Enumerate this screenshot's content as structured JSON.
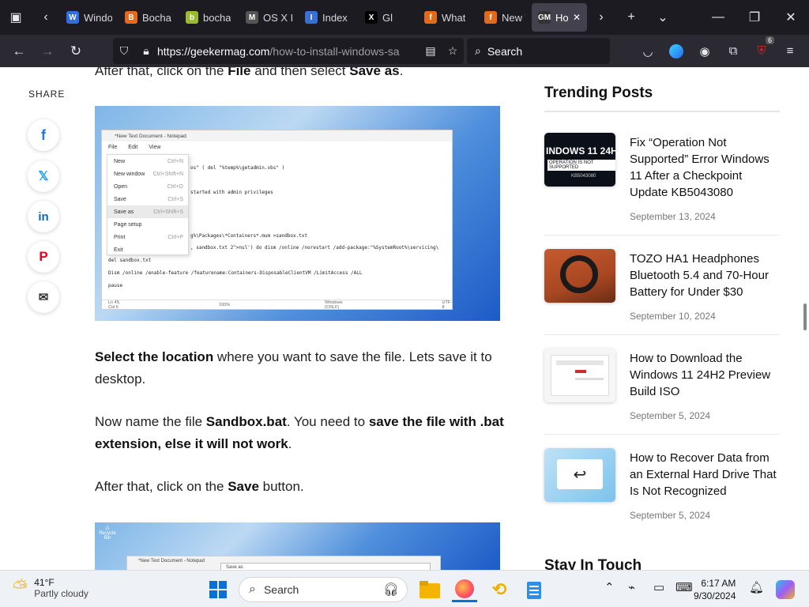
{
  "browser": {
    "tabs": [
      {
        "label": "Windo",
        "fav": "W",
        "color": "#2f6fe0"
      },
      {
        "label": "Bocha",
        "fav": "B",
        "color": "#e56a1e"
      },
      {
        "label": "bocha",
        "fav": "b",
        "color": "#9bbb2e"
      },
      {
        "label": "OS X I",
        "fav": "M",
        "color": "#555555"
      },
      {
        "label": "Index",
        "fav": "I",
        "color": "#3a6fd8"
      },
      {
        "label": "Gl",
        "fav": "X",
        "color": "#000000"
      },
      {
        "label": "What",
        "fav": "f",
        "color": "#e26a1b"
      },
      {
        "label": "New T",
        "fav": "f",
        "color": "#e26a1b"
      },
      {
        "label": "Ho",
        "fav": "GM",
        "color": "#333333",
        "active": true
      }
    ],
    "url_host": "https://geekermag.com",
    "url_path": "/how-to-install-windows-sa",
    "search_placeholder": "Search",
    "extension_badge": "6"
  },
  "article": {
    "share_label": "SHARE",
    "p0_pre": "After that, click on the ",
    "p0_b1": "File",
    "p0_mid": " and then select ",
    "p0_b2": "Save as",
    "p0_end": ".",
    "p1_b": "Select the location",
    "p1_rest": " where you want to save the file. Lets save it to desktop.",
    "p2_pre": "Now name the file ",
    "p2_b1": "Sandbox.bat",
    "p2_mid": ". You need to ",
    "p2_b2": "save the file with .bat extension, else it will not work",
    "p2_end": ".",
    "p3_pre": "After that, click on the ",
    "p3_b": "Save",
    "p3_end": " button."
  },
  "notepad": {
    "title": "*New Text Document - Notepad",
    "menu": [
      "File",
      "Edit",
      "View"
    ],
    "items": [
      {
        "label": "New",
        "key": "Ctrl+N"
      },
      {
        "label": "New window",
        "key": "Ctrl+Shift+N"
      },
      {
        "label": "Open",
        "key": "Ctrl+O"
      },
      {
        "label": "Save",
        "key": "Ctrl+S"
      },
      {
        "label": "Save as",
        "key": "Ctrl+Shift+S"
      },
      {
        "label": "Page setup",
        "key": ""
      },
      {
        "label": "Print",
        "key": "Ctrl+P"
      },
      {
        "label": "Exit",
        "key": ""
      }
    ],
    "code1": "os\" ( del \"%temp%\\getadmin.vbs\" )",
    "code2": "started with admin privileges",
    "code3": "g%\\Packages\\*Containers*.mum >sandbox.txt",
    "code4": ", sandbox.txt 2^>nul') do dism /online /norestart /add-package:\"%SystemRoot%\\servicing\\",
    "code5": "del sandbox.txt",
    "code6": "Dism /online /enable-feature /featurename:Containers-DisposableClientVM /LimitAccess /ALL",
    "code7": "pause",
    "status": [
      "Ln 45, Col 6",
      "100%",
      "Windows (CRLF)",
      "UTF-8"
    ],
    "second_title": "*New Text Document - Notepad",
    "second_dialog": "Save as",
    "desktop_icon": "Recycle Bin"
  },
  "sidebar": {
    "title": "Trending Posts",
    "subtitle": "Stay In Touch",
    "posts": [
      {
        "title": "Fix “Operation Not Supported” Error Windows 11 After a Checkpoint Update KB5043080",
        "date": "September 13, 2024",
        "thumb_title": "INDOWS 11 24H",
        "thumb_sub": "OPERATION IS NOT SUPPORTED",
        "thumb_code": "KB5043080"
      },
      {
        "title": "TOZO HA1 Headphones Bluetooth 5.4 and 70-Hour Battery for Under $30",
        "date": "September 10, 2024"
      },
      {
        "title": "How to Download the Windows 11 24H2 Preview Build ISO",
        "date": "September 5, 2024"
      },
      {
        "title": "How to Recover Data from an External Hard Drive That Is Not Recognized",
        "date": "September 5, 2024"
      }
    ]
  },
  "taskbar": {
    "temp": "41°F",
    "condition": "Partly cloudy",
    "search": "Search",
    "time": "6:17 AM",
    "date": "9/30/2024"
  }
}
